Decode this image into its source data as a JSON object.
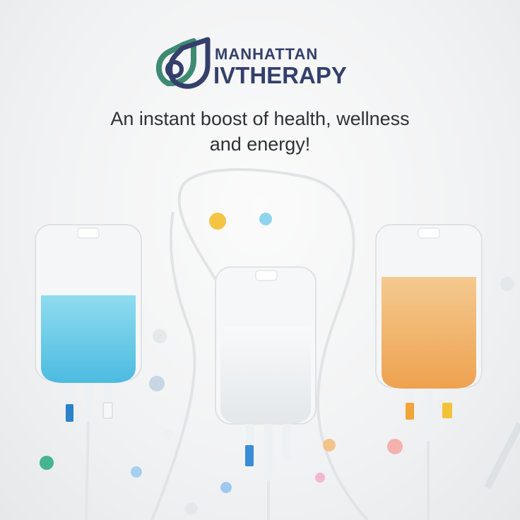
{
  "brand": {
    "name_top": "MANHATTAN",
    "name_bottom": "IVTHERAPY",
    "logo_colors": {
      "green": "#3f8a73",
      "navy": "#34406b"
    }
  },
  "headline": {
    "line1": "An instant boost of health, wellness",
    "line2": "and energy!"
  },
  "image": {
    "subject": "three IV bags",
    "fluid_colors": [
      "#69cbe8",
      "#eef1f2",
      "#f0b26a"
    ],
    "connector_colors": [
      "#2b82c8",
      "#3a8cd6",
      "#f2a33a"
    ]
  }
}
